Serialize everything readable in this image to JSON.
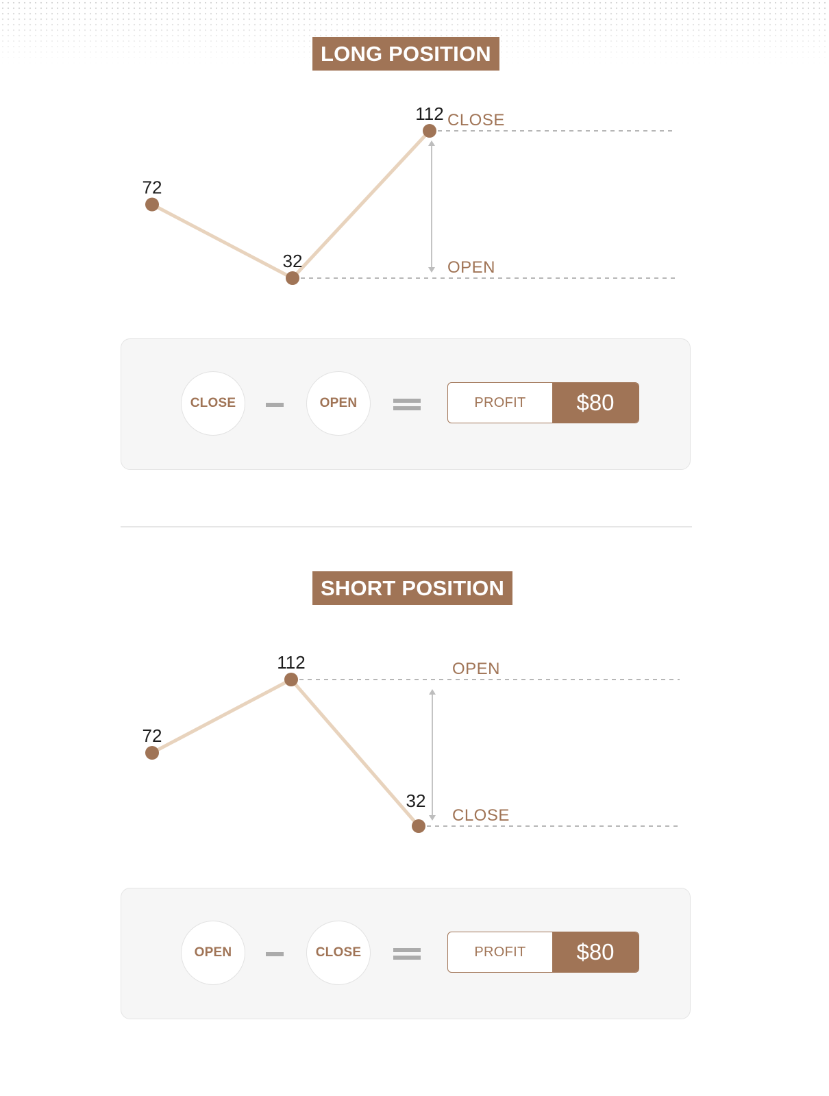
{
  "long": {
    "title": "LONG POSITION",
    "open_label": "OPEN",
    "close_label": "CLOSE",
    "formula": {
      "first": "CLOSE",
      "op": "minus",
      "second": "OPEN",
      "eq": "equals",
      "result_label": "PROFIT",
      "result_value": "$80"
    }
  },
  "short": {
    "title": "SHORT POSITION",
    "open_label": "OPEN",
    "close_label": "CLOSE",
    "formula": {
      "first": "OPEN",
      "op": "minus",
      "second": "CLOSE",
      "eq": "equals",
      "result_label": "PROFIT",
      "result_value": "$80"
    }
  },
  "colors": {
    "accent": "#a07456",
    "line": "#e8d3bd",
    "dashed": "#9e9e9e",
    "arrow": "#bdbdbd",
    "panel": "#f6f6f6"
  },
  "chart_data": [
    {
      "type": "line",
      "title": "LONG POSITION",
      "x": [
        1,
        2,
        3
      ],
      "values": [
        72,
        32,
        112
      ],
      "data_labels": [
        "72",
        "32",
        "112"
      ],
      "reference_lines": [
        {
          "label": "OPEN",
          "value": 32
        },
        {
          "label": "CLOSE",
          "value": 112
        }
      ],
      "ylim": [
        32,
        112
      ],
      "grid": false,
      "annotation": "double arrow between OPEN (32) and CLOSE (112)"
    },
    {
      "type": "line",
      "title": "SHORT POSITION",
      "x": [
        1,
        2,
        3
      ],
      "values": [
        72,
        112,
        32
      ],
      "data_labels": [
        "72",
        "112",
        "32"
      ],
      "reference_lines": [
        {
          "label": "OPEN",
          "value": 112
        },
        {
          "label": "CLOSE",
          "value": 32
        }
      ],
      "ylim": [
        32,
        112
      ],
      "grid": false,
      "annotation": "double arrow between OPEN (112) and CLOSE (32)"
    }
  ]
}
